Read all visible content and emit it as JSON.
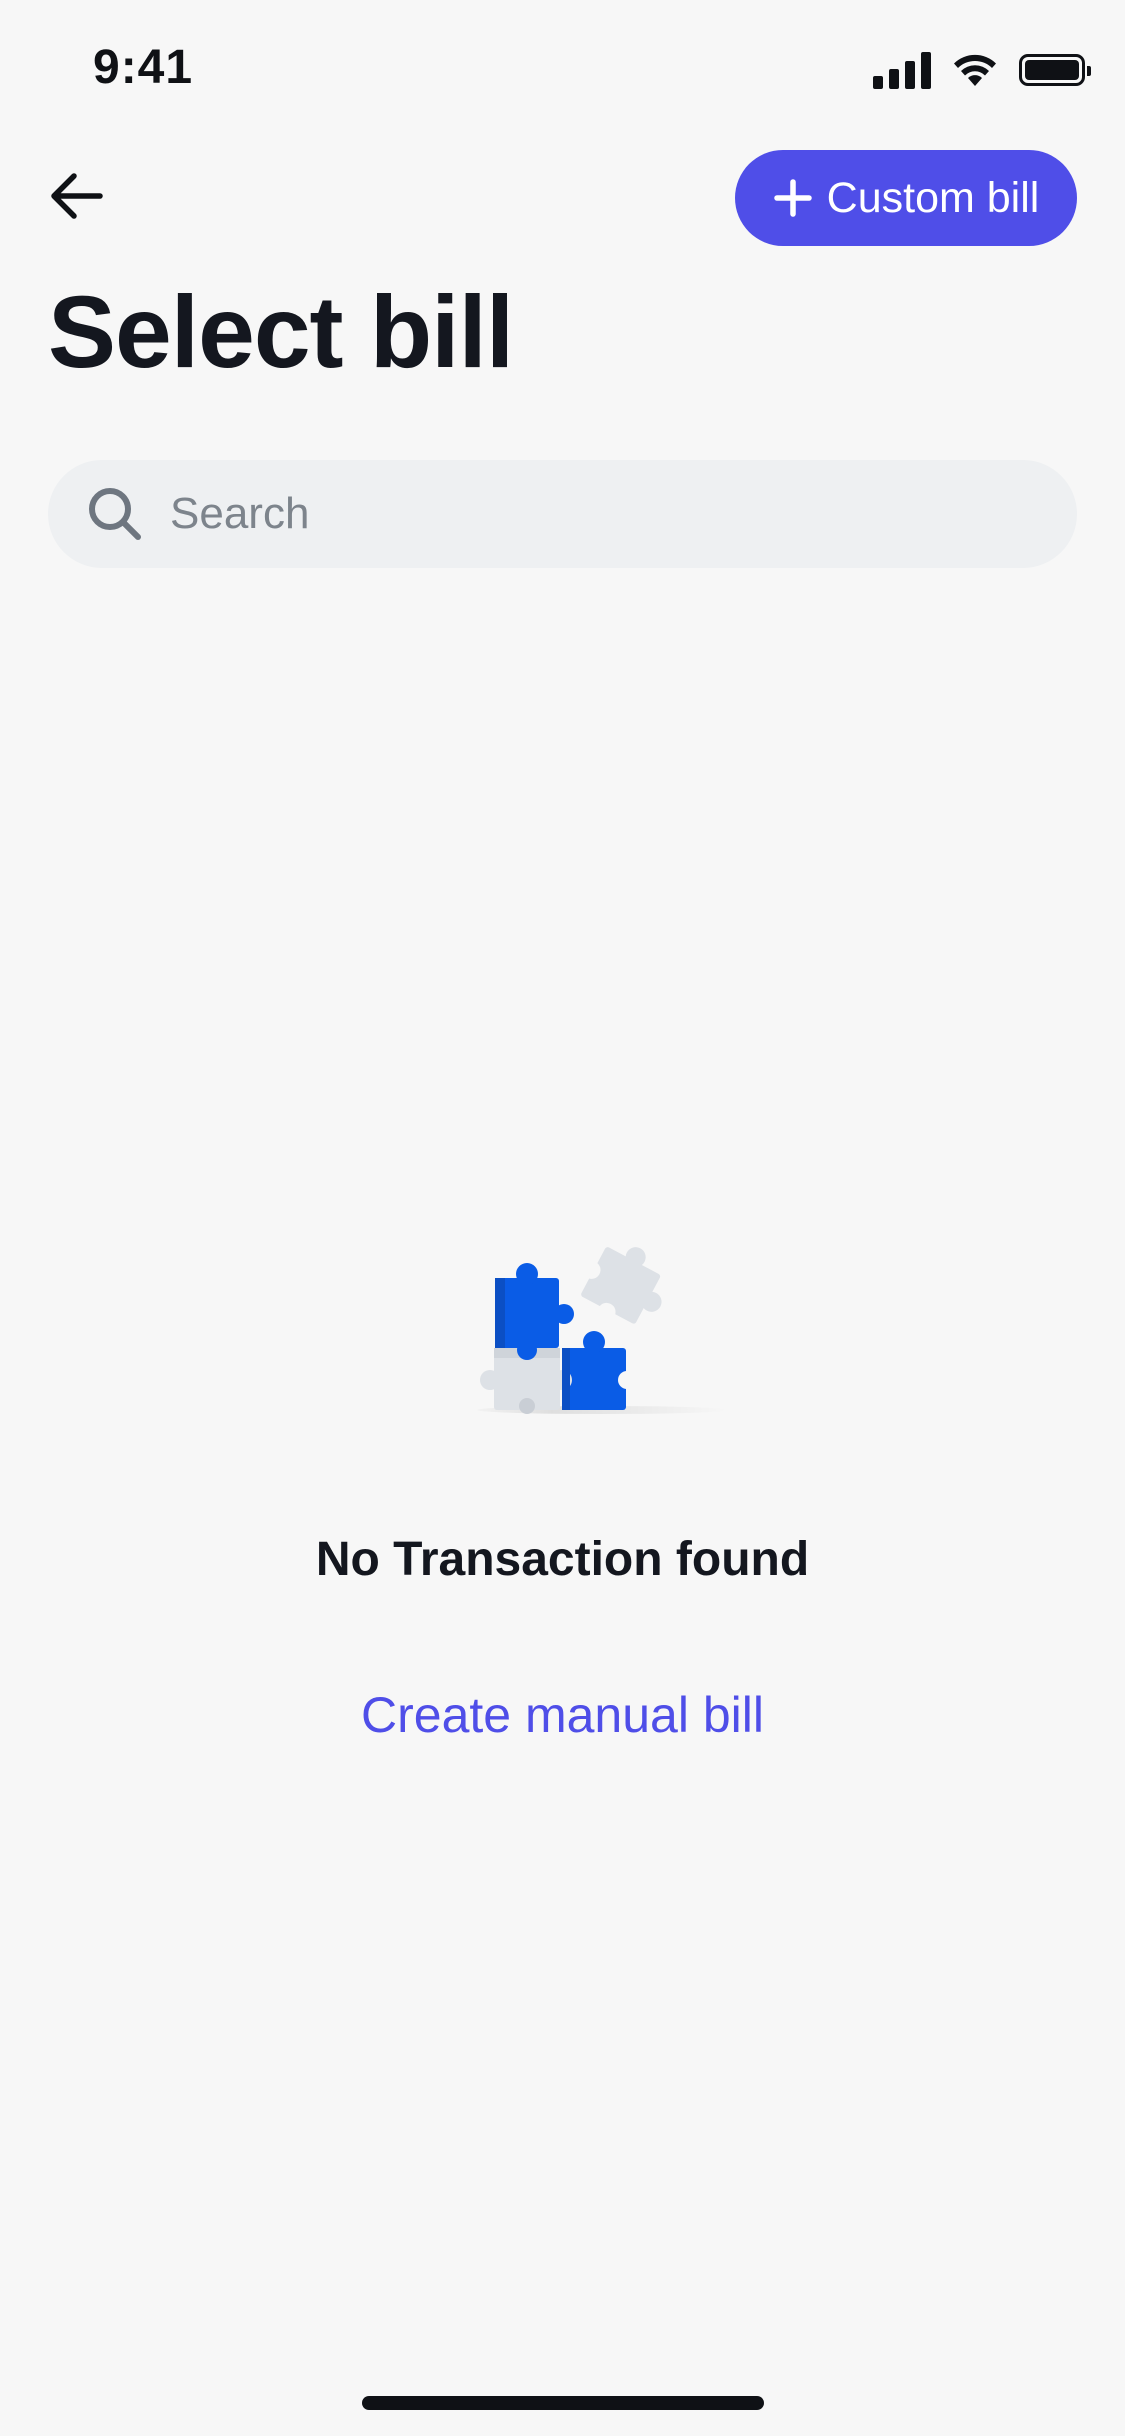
{
  "status_bar": {
    "time": "9:41",
    "icons": [
      "cellular-signal-icon",
      "wifi-icon",
      "battery-icon"
    ]
  },
  "header": {
    "back_icon": "arrow-left-icon",
    "custom_bill_label": "Custom bill",
    "custom_bill_icon": "plus-icon",
    "title": "Select bill"
  },
  "search": {
    "placeholder": "Search",
    "value": "",
    "icon": "search-icon"
  },
  "empty_state": {
    "illustration": "puzzle-pieces-illustration",
    "message": "No Transaction found",
    "action_label": "Create manual bill"
  },
  "colors": {
    "accent": "#4f4ee8",
    "background": "#f7f7f7",
    "search_background": "#eef0f2",
    "puzzle_blue": "#0a5ce6",
    "puzzle_gray": "#dde1e6"
  }
}
